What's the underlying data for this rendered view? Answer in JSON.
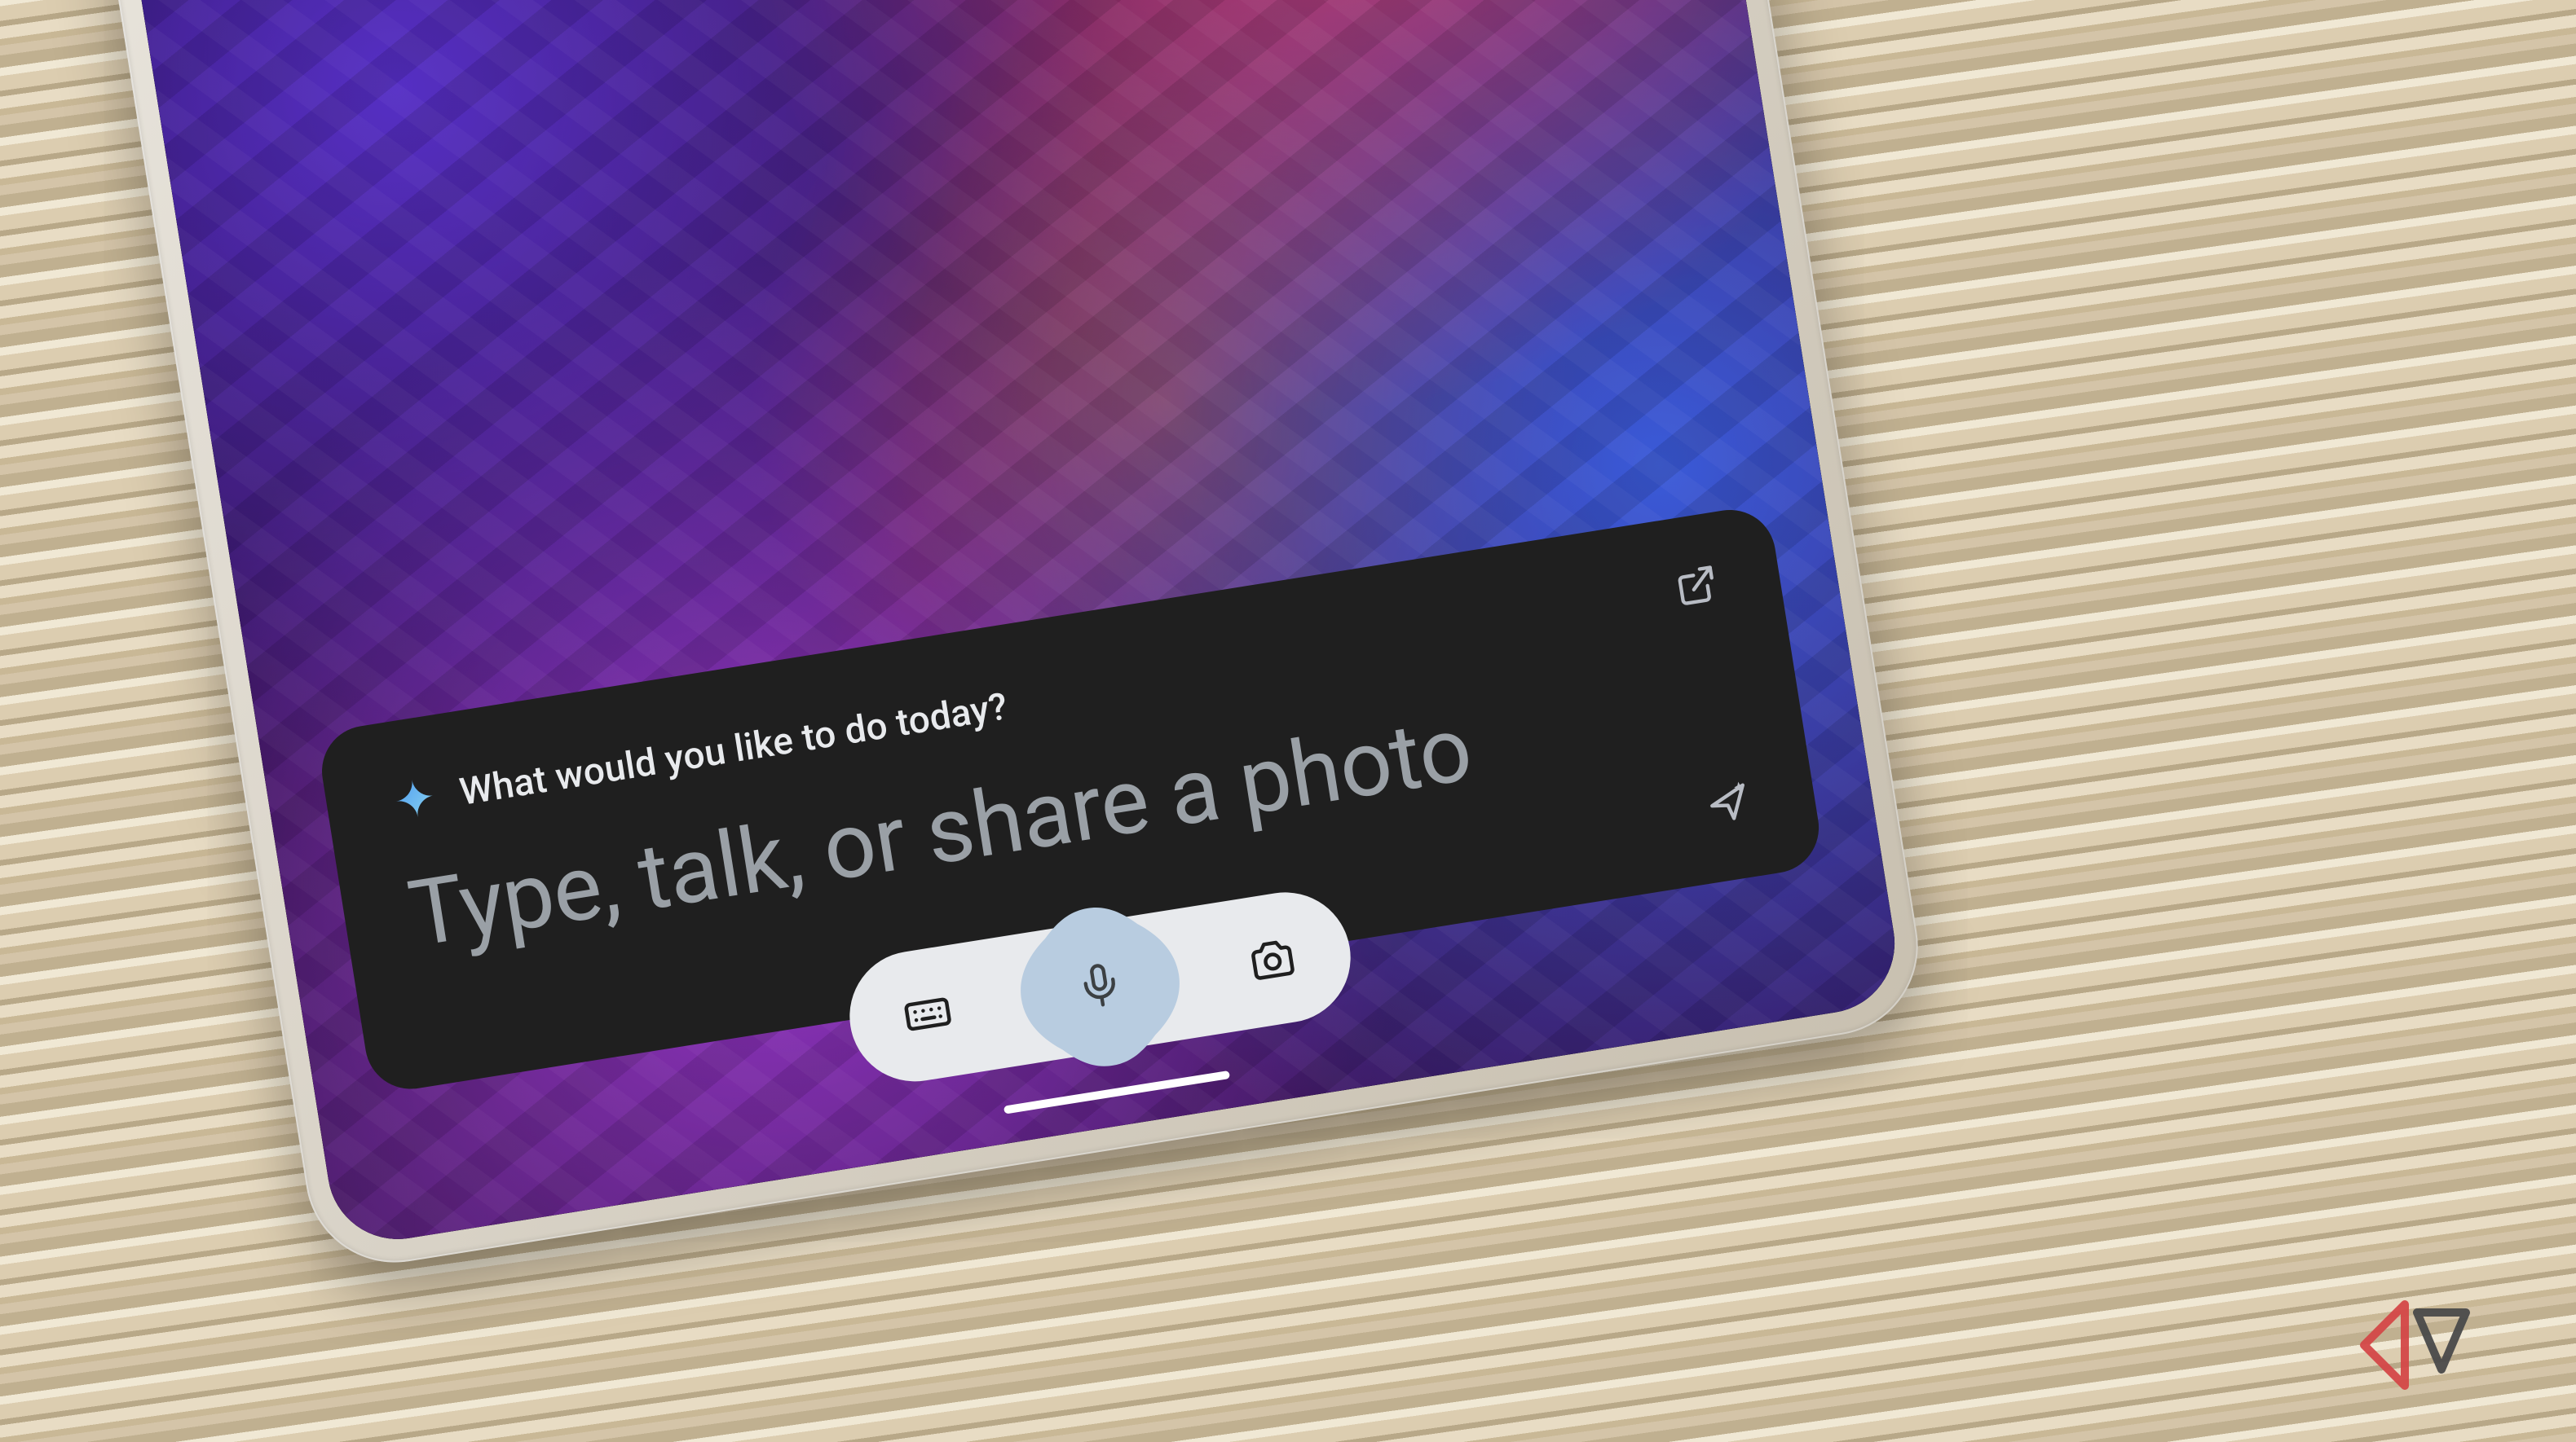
{
  "assistant": {
    "prompt_label": "What would you like to do today?",
    "placeholder": "Type, talk, or share a photo",
    "icons": {
      "sparkle": "gemini-sparkle",
      "expand": "open-external",
      "send": "send-sparkle",
      "keyboard": "keyboard",
      "mic": "microphone",
      "camera": "camera"
    }
  },
  "colors": {
    "card_bg": "#1f1f1f",
    "text_primary": "#e8eaed",
    "text_placeholder": "#9aa0a6",
    "pill_bg": "#e8eaed",
    "mic_blob": "#b8cce0",
    "sparkle_gradient_start": "#4f9cf0",
    "sparkle_gradient_end": "#8ad4f0"
  }
}
